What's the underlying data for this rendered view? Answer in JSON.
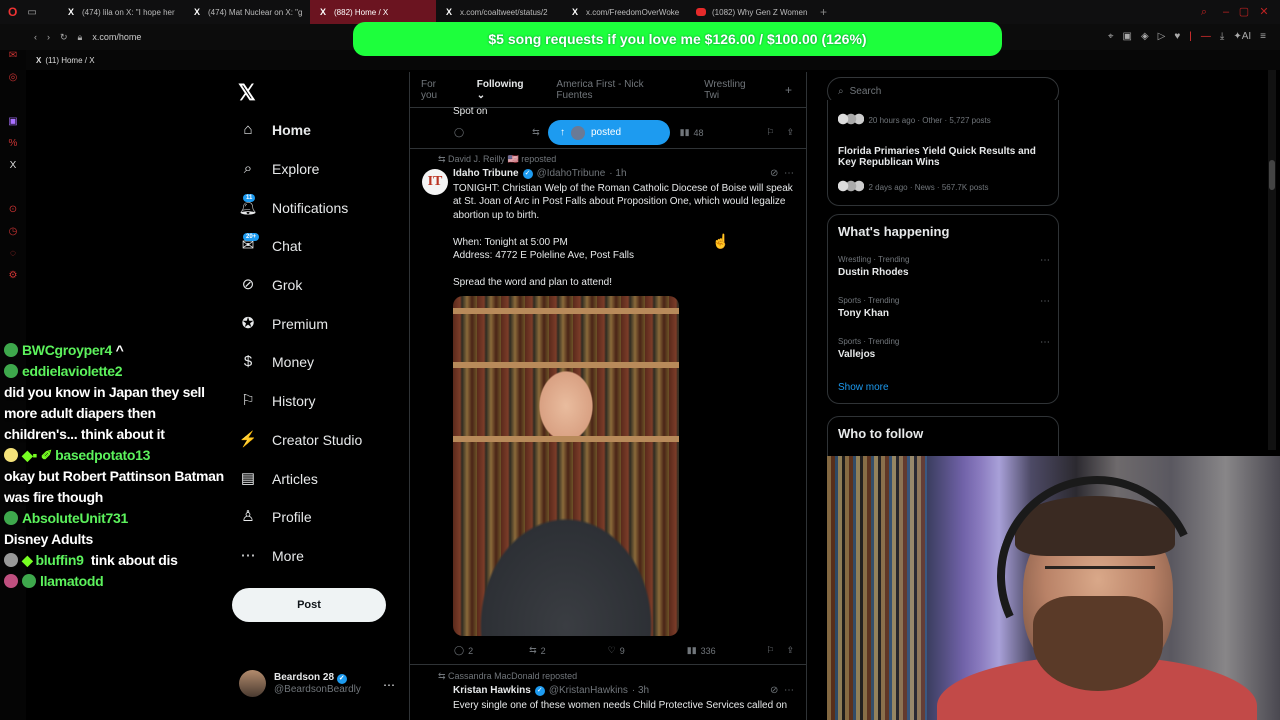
{
  "browser": {
    "tabs": [
      {
        "label": "(474) lila on X: \"I hope her",
        "favicon": "X",
        "active": false
      },
      {
        "label": "(474) Mat Nuclear on X: \"g",
        "favicon": "X",
        "active": false
      },
      {
        "label": "(882) Home / X",
        "favicon": "X",
        "active": true
      },
      {
        "label": "x.com/coaltweet/status/2",
        "favicon": "X",
        "active": false
      },
      {
        "label": "x.com/FreedomOverWoke",
        "favicon": "X",
        "active": false
      },
      {
        "label": "(1082) Why Gen Z Women",
        "favicon": "youtube",
        "active": false
      }
    ],
    "url": "x.com/home",
    "bookmark_label": "(11) Home / X"
  },
  "banner": {
    "text": "$5 song requests if you love me $126.00 / $100.00 (126%)",
    "color": "#1dff3c"
  },
  "x_nav": {
    "items": [
      {
        "label": "Home",
        "icon": "home-icon"
      },
      {
        "label": "Explore",
        "icon": "search-icon"
      },
      {
        "label": "Notifications",
        "icon": "bell-icon",
        "badge": "11"
      },
      {
        "label": "Chat",
        "icon": "chat-icon",
        "badge": "20+"
      },
      {
        "label": "Grok",
        "icon": "grok-icon"
      },
      {
        "label": "Premium",
        "icon": "premium-icon"
      },
      {
        "label": "Money",
        "icon": "money-icon"
      },
      {
        "label": "History",
        "icon": "bookmark-icon"
      },
      {
        "label": "Creator Studio",
        "icon": "creator-icon"
      },
      {
        "label": "Articles",
        "icon": "articles-icon"
      },
      {
        "label": "Profile",
        "icon": "profile-icon"
      },
      {
        "label": "More",
        "icon": "more-icon"
      }
    ],
    "post_button": "Post",
    "account": {
      "name": "Beardson 28",
      "handle": "@BeardsonBeardly"
    }
  },
  "chat": [
    {
      "user": "BWCgroyper4",
      "message": "^"
    },
    {
      "user": "eddielaviolette2",
      "message": "did you know in Japan they sell more adult diapers then children's... think about it"
    },
    {
      "user": "basedpotato13",
      "message": "okay but Robert Pattinson Batman was fire though"
    },
    {
      "user": "AbsoluteUnit731",
      "message": "Disney Adults"
    },
    {
      "user": "bluffin9",
      "message": "tink about dis"
    },
    {
      "user": "llamatodd",
      "message": ""
    }
  ],
  "timeline": {
    "tabs": [
      "For you",
      "Following",
      "America First - Nick Fuentes",
      "Wrestling Twi"
    ],
    "active_tab": "Following",
    "prev_tweet": {
      "text": "Spot on",
      "views": "48"
    },
    "posted_pill": "posted",
    "tweet1": {
      "reposted_by": "David J. Reilly 🇺🇸 reposted",
      "name": "Idaho Tribune",
      "handle": "@IdahoTribune",
      "time": "· 1h",
      "text1": "TONIGHT: Christian Welp of the Roman Catholic Diocese of Boise will speak at St. Joan of Arc in Post Falls about Proposition One, which would legalize abortion up to birth.",
      "text2": "When: Tonight at 5:00 PM",
      "text3": "Address: 4772 E Poleline Ave, Post Falls",
      "text4": "Spread the word and plan to attend!",
      "replies": "2",
      "reposts": "2",
      "likes": "9",
      "views": "336"
    },
    "tweet2": {
      "reposted_by": "Cassandra MacDonald reposted",
      "name": "Kristan Hawkins",
      "handle": "@KristanHawkins",
      "time": "· 3h",
      "text": "Every single one of these women needs Child Protective Services called on"
    }
  },
  "right": {
    "search_placeholder": "Search",
    "top_card": {
      "meta1": "20 hours ago · Other · 5,727 posts",
      "title2": "Florida Primaries Yield Quick Results and Key Republican Wins",
      "meta2": "2 days ago · News · 567.7K posts"
    },
    "happening": {
      "title": "What's happening",
      "trends": [
        {
          "meta": "Wrestling · Trending",
          "name": "Dustin Rhodes"
        },
        {
          "meta": "Sports · Trending",
          "name": "Tony Khan"
        },
        {
          "meta": "Sports · Trending",
          "name": "Vallejos"
        }
      ],
      "show_more": "Show more"
    },
    "who_to_follow": "Who to follow"
  }
}
